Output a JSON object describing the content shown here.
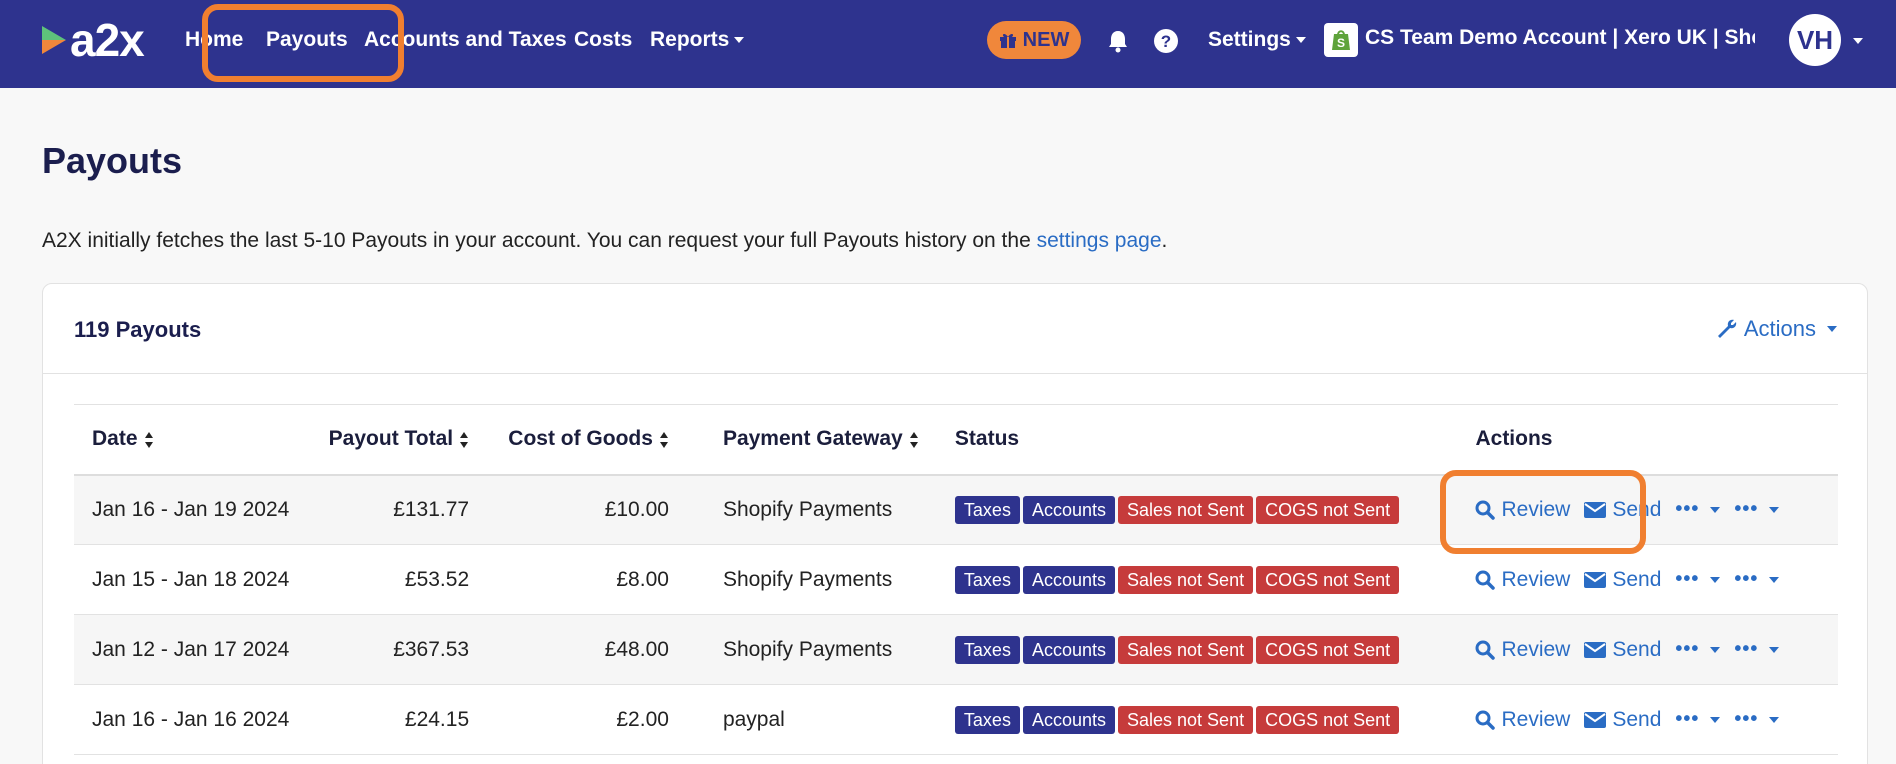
{
  "nav": {
    "logo": "a2x",
    "links": [
      "Home",
      "Payouts",
      "Accounts and Taxes",
      "Costs",
      "Reports"
    ],
    "new_badge": "NEW",
    "settings": "Settings",
    "account": "CS Team Demo Account | Xero UK | Sho...",
    "avatar": "VH"
  },
  "page": {
    "title": "Payouts",
    "intro_text": "A2X initially fetches the last 5-10 Payouts in your account. You can request your full Payouts history on the ",
    "intro_link": "settings page",
    "intro_end": "."
  },
  "card": {
    "title": "119 Payouts",
    "actions_label": "Actions"
  },
  "table": {
    "headers": [
      "Date",
      "Payout Total",
      "Cost of Goods",
      "Payment Gateway",
      "Status",
      "Actions"
    ],
    "rows": [
      {
        "date": "Jan 16 - Jan 19 2024",
        "total": "£131.77",
        "cogs": "£10.00",
        "gateway": "Shopify Payments"
      },
      {
        "date": "Jan 15 - Jan 18 2024",
        "total": "£53.52",
        "cogs": "£8.00",
        "gateway": "Shopify Payments"
      },
      {
        "date": "Jan 12 - Jan 17 2024",
        "total": "£367.53",
        "cogs": "£48.00",
        "gateway": "Shopify Payments"
      },
      {
        "date": "Jan 16 - Jan 16 2024",
        "total": "£24.15",
        "cogs": "£2.00",
        "gateway": "paypal"
      }
    ],
    "status_badges": [
      "Taxes",
      "Accounts",
      "Sales not Sent",
      "COGS not Sent"
    ],
    "review_label": "Review",
    "send_label": "Send"
  },
  "colors": {
    "nav_bg": "#2e338e",
    "accent_orange": "#f07f30",
    "link_blue": "#2a6cc4",
    "badge_red": "#c63b3b"
  }
}
